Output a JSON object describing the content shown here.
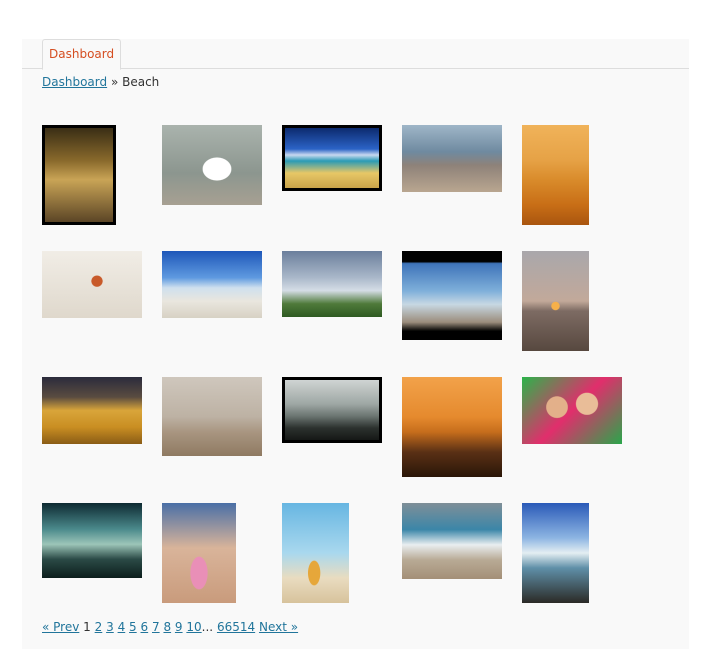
{
  "tabs": [
    {
      "label": "Dashboard"
    }
  ],
  "breadcrumb": {
    "link": "Dashboard",
    "separator": "»",
    "current": "Beach"
  },
  "gallery": {
    "thumbnails": [
      {
        "name": "thumb-pier-posts",
        "bg": "linear-gradient(180deg,#3a2e15 0%,#8a6a2c 35%,#c9a456 55%,#5b4526 100%)",
        "border": "#000"
      },
      {
        "name": "thumb-white-ibis",
        "bg": "radial-gradient(ellipse at 55% 55%,#ffffff 0 18%,transparent 19%),linear-gradient(180deg,#aab3ad,#8c968f 60%,#a7a092)"
      },
      {
        "name": "thumb-tropical-beach",
        "bg": "linear-gradient(180deg,#0c2a6e 0%,#2b63c6 35%,#c8d8f0 45%,#2a9bb5 55%,#e7c766 75%,#c9a34a 100%)",
        "border": "#000"
      },
      {
        "name": "thumb-couple-beach",
        "bg": "linear-gradient(180deg,#9fb6c8 0%,#6f8aa0 40%,#8e8279 60%,#b9a690 100%)"
      },
      {
        "name": "thumb-orange-sunset",
        "bg": "linear-gradient(180deg,#f0b35a 0%,#e6a246 35%,#d98b2b 55%,#c86e16 80%,#a9550f 100%)"
      },
      {
        "name": "thumb-kid-sand",
        "bg": "radial-gradient(circle at 55% 45%,#c85a2a 0 8%,transparent 9%),linear-gradient(180deg,#f1ede6,#dfd8cc)"
      },
      {
        "name": "thumb-blue-sky-shore",
        "bg": "linear-gradient(180deg,#1e57b9 0%,#5f9ae0 40%,#cfe0ee 55%,#e9e6de 75%,#d7d1c4 100%)"
      },
      {
        "name": "thumb-lighthouse",
        "bg": "linear-gradient(180deg,#6b7f9c 0%,#a9b7c9 40%,#d5dde6 60%,#4f7a3a 80%,#2e5a22 100%)"
      },
      {
        "name": "thumb-wave-shore",
        "bg": "linear-gradient(180deg,#000 0%,#000 12%,#3e73b9 14%,#7fb0da 45%,#c7d8e3 60%,#9b8d7c 80%,#000 90%,#000 100%)"
      },
      {
        "name": "thumb-dusk-sea",
        "bg": "radial-gradient(circle at 50% 55%,#f6b04a 0 6%,transparent 7%),linear-gradient(180deg,#a9a7ab 0%,#c2a99a 50%,#7d6b63 60%,#57483f 100%)"
      },
      {
        "name": "thumb-bird-sand",
        "bg": "linear-gradient(180deg,#2b2b3c 0%,#5a4c40 30%,#d9a53a 50%,#c98e22 75%,#8a5c16 100%)"
      },
      {
        "name": "thumb-hazy-beach",
        "bg": "linear-gradient(180deg,#cfc7bd 0%,#bdb2a4 50%,#a89580 70%,#8f7a62 100%)"
      },
      {
        "name": "thumb-pier-mountains",
        "bg": "linear-gradient(180deg,#cfd4d3 0%,#9ea7a4 40%,#6c7672 60%,#2c312e 80%,#151816 100%)",
        "border": "#000"
      },
      {
        "name": "thumb-silhouette-sunset",
        "bg": "linear-gradient(180deg,#f2a24a 0%,#e58a2e 40%,#c66d1c 55%,#5a3015 75%,#2a1608 100%)"
      },
      {
        "name": "thumb-girls-hammock",
        "bg": "radial-gradient(circle at 35% 45%,#e3b08a 0 14%,transparent 15%),radial-gradient(circle at 65% 40%,#e9bd98 0 14%,transparent 15%),linear-gradient(135deg,#2bb44a 0%,#e12e6c 50%,#2aa64b 100%)"
      },
      {
        "name": "thumb-storm-clouds",
        "bg": "linear-gradient(180deg,#0e2a32 0%,#4b8a8c 35%,#9cc5b8 55%,#2b4a46 75%,#0c1e1c 100%)"
      },
      {
        "name": "thumb-bikini-back",
        "bg": "radial-gradient(ellipse at 50% 70%,#e98fb7 0 16%,transparent 17%),linear-gradient(180deg,#4a6fa6 0%,#d9b49a 45%,#c99b7c 100%)"
      },
      {
        "name": "thumb-beer-bottle",
        "bg": "radial-gradient(ellipse at 48% 70%,#e6a73a 0 12%,transparent 13%),linear-gradient(180deg,#67b6e2 0%,#a9d8ee 50%,#e9dcc0 75%,#d7c39c 100%)"
      },
      {
        "name": "thumb-surf-woman",
        "bg": "linear-gradient(180deg,#7f8f98 0%,#3b86a8 35%,#e9eef0 55%,#b8aa95 75%,#a38f77 100%)"
      },
      {
        "name": "thumb-rocky-shore",
        "bg": "linear-gradient(180deg,#2a5ab8 0%,#8db5e2 35%,#e4eef2 50%,#5f8fa8 65%,#2b2a26 100%)"
      }
    ]
  },
  "pagination": {
    "prev": "« Prev",
    "current": "1",
    "pages": [
      "2",
      "3",
      "4",
      "5",
      "6",
      "7",
      "8",
      "9",
      "10"
    ],
    "ellipsis": "...",
    "last": "66514",
    "next": "Next »"
  }
}
